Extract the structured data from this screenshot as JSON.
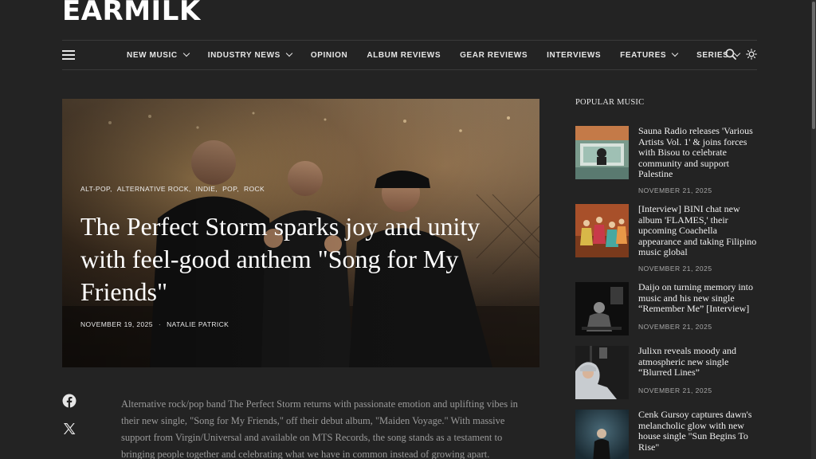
{
  "brand": {
    "logo": "EARMILK"
  },
  "nav": {
    "items": [
      {
        "label": "NEW MUSIC",
        "has_dropdown": true
      },
      {
        "label": "INDUSTRY NEWS",
        "has_dropdown": true
      },
      {
        "label": "OPINION",
        "has_dropdown": false
      },
      {
        "label": "ALBUM REVIEWS",
        "has_dropdown": false
      },
      {
        "label": "GEAR REVIEWS",
        "has_dropdown": false
      },
      {
        "label": "INTERVIEWS",
        "has_dropdown": false
      },
      {
        "label": "FEATURES",
        "has_dropdown": true
      },
      {
        "label": "SERIES",
        "has_dropdown": true
      }
    ],
    "icons": {
      "menu": "hamburger-menu-icon",
      "search": "search-icon",
      "theme": "sun-icon"
    }
  },
  "hero": {
    "tags": [
      "ALT-POP,",
      "ALTERNATIVE ROCK,",
      "INDIE,",
      "POP,",
      "ROCK"
    ],
    "title": "The Perfect Storm sparks joy and unity with feel-good anthem \"Song for My Friends\"",
    "date": "NOVEMBER 19, 2025",
    "separator": "·",
    "author": "NATALIE PATRICK"
  },
  "share": {
    "icons": [
      "facebook-icon",
      "x-icon"
    ]
  },
  "article": {
    "intro": "Alternative rock/pop band The Perfect Storm returns with passionate emotion and uplifting vibes in their new single, \"Song for My Friends,\" off their debut album, \"Maiden Voyage.\" With massive support from Virgin/Universal and available on MTS Records, the song stands as a testament to bringing people together and celebrating what we have in common instead of growing apart."
  },
  "sidebar": {
    "heading": "POPULAR MUSIC",
    "items": [
      {
        "title": "Sauna Radio releases 'Various Artists Vol. 1' & joins forces with Bisou to celebrate community and support Palestine",
        "date": "NOVEMBER 21, 2025"
      },
      {
        "title": "[Interview] BINI chat new album 'FLAMES,' their upcoming Coachella appearance and taking Filipino music global",
        "date": "NOVEMBER 21, 2025"
      },
      {
        "title": "Daijo on turning memory into music and his new single “Remember Me” [Interview]",
        "date": "NOVEMBER 21, 2025"
      },
      {
        "title": "Julixn reveals moody and atmospheric new single “Blurred Lines”",
        "date": "NOVEMBER 21, 2025"
      },
      {
        "title": "Cenk Gursoy captures dawn's melancholic glow with new house single \"Sun Begins To Rise\"",
        "date": ""
      }
    ]
  },
  "colors": {
    "background": "#232323",
    "text": "#e8e8e8",
    "muted": "#9a9a9a",
    "divider": "#3a3a3a"
  }
}
